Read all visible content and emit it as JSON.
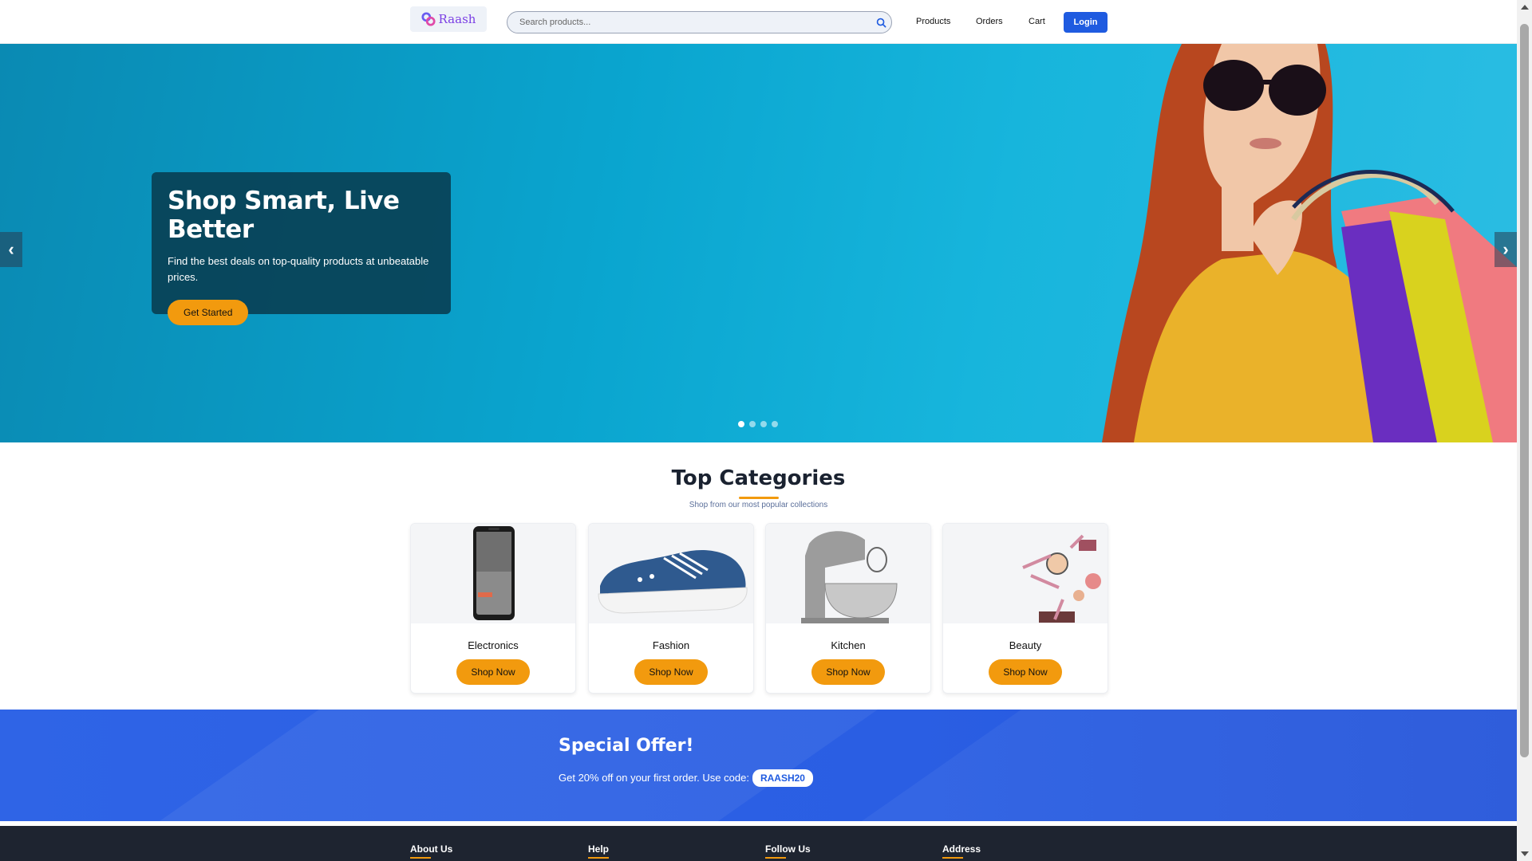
{
  "header": {
    "logo_text": "Raash",
    "search_placeholder": "Search products...",
    "nav": [
      "Products",
      "Orders",
      "Cart"
    ],
    "login_label": "Login"
  },
  "hero": {
    "title": "Shop Smart, Live Better",
    "subtitle": "Find the best deals on top-quality products at unbeatable prices.",
    "cta_label": "Get Started",
    "prev_arrow": "‹",
    "next_arrow": "›",
    "slide_count": 4,
    "active_slide": 1
  },
  "categories": {
    "title": "Top Categories",
    "subtitle": "Shop from our most popular collections",
    "items": [
      {
        "name": "Electronics",
        "button": "Shop Now"
      },
      {
        "name": "Fashion",
        "button": "Shop Now"
      },
      {
        "name": "Kitchen",
        "button": "Shop Now"
      },
      {
        "name": "Beauty",
        "button": "Shop Now"
      }
    ]
  },
  "offer": {
    "title": "Special Offer!",
    "text": "Get 20% off on your first order. Use code:",
    "code": "RAASH20"
  },
  "footer": {
    "headings": [
      "About Us",
      "Help",
      "Follow Us",
      "Address"
    ]
  },
  "colors": {
    "primary": "#1f5be0",
    "accent": "#f29a0e",
    "hero_bg": "#0aa5cf",
    "footer_bg": "#1e2430"
  }
}
